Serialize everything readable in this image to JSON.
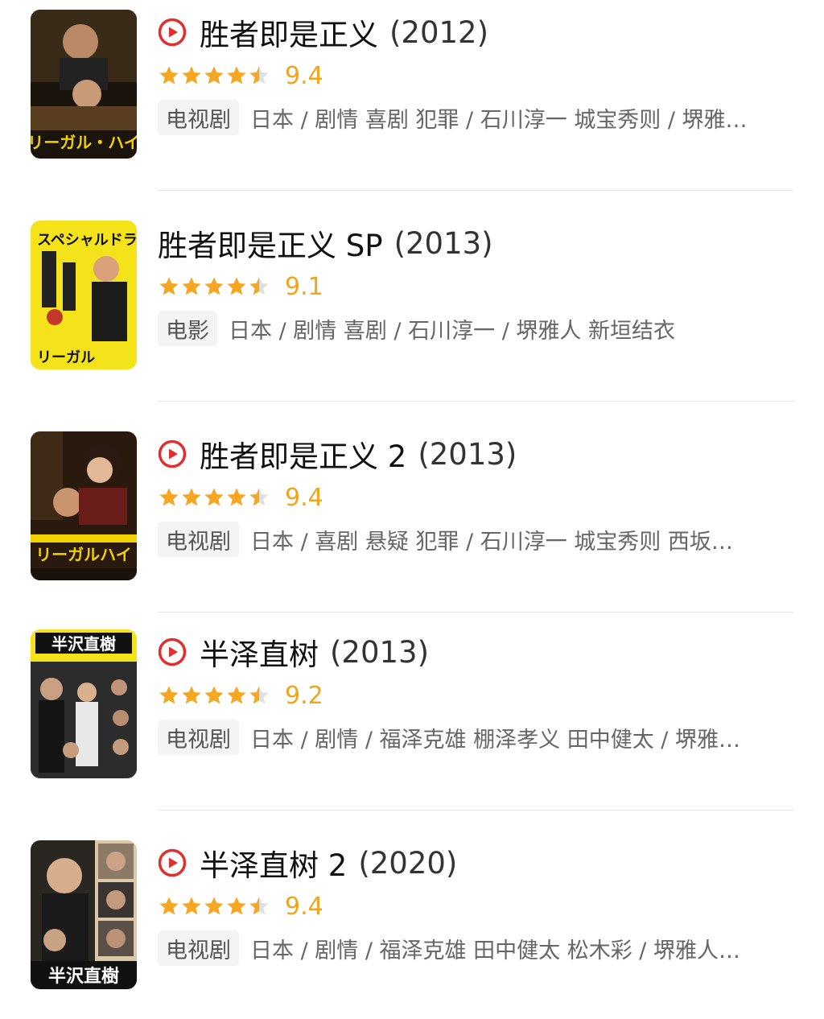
{
  "items": [
    {
      "has_play": true,
      "title": "胜者即是正义",
      "year": "(2012)",
      "score": "9.4",
      "rating_stars": 4.5,
      "type": "电视剧",
      "meta": "日本 / 剧情 喜剧 犯罪 / 石川淳一 城宝秀则 / 堺雅…",
      "poster_icon": "legal-high-poster"
    },
    {
      "has_play": false,
      "title": "胜者即是正义 SP",
      "year": "(2013)",
      "score": "9.1",
      "rating_stars": 4.5,
      "type": "电影",
      "meta": "日本 / 剧情 喜剧 / 石川淳一 / 堺雅人 新垣结衣",
      "poster_icon": "legal-high-sp-poster"
    },
    {
      "has_play": true,
      "title": "胜者即是正义 2",
      "year": "(2013)",
      "score": "9.4",
      "rating_stars": 4.5,
      "type": "电视剧",
      "meta": "日本 / 喜剧 悬疑 犯罪 / 石川淳一 城宝秀则 西坂…",
      "poster_icon": "legal-high-2-poster"
    },
    {
      "has_play": true,
      "title": "半泽直树",
      "year": "(2013)",
      "score": "9.2",
      "rating_stars": 4.5,
      "type": "电视剧",
      "meta": "日本 / 剧情 / 福泽克雄 棚泽孝义 田中健太 / 堺雅…",
      "poster_icon": "hanzawa-naoki-poster"
    },
    {
      "has_play": true,
      "title": "半泽直树 2",
      "year": "(2020)",
      "score": "9.4",
      "rating_stars": 4.5,
      "type": "电视剧",
      "meta": "日本 / 剧情 / 福泽克雄 田中健太 松木彩 / 堺雅人…",
      "poster_icon": "hanzawa-naoki-2-poster"
    }
  ],
  "colors": {
    "play_red": "#e02f2f",
    "star_orange": "#f5a623",
    "star_gray": "#e0e0e0",
    "score_orange": "#f0a51e"
  }
}
